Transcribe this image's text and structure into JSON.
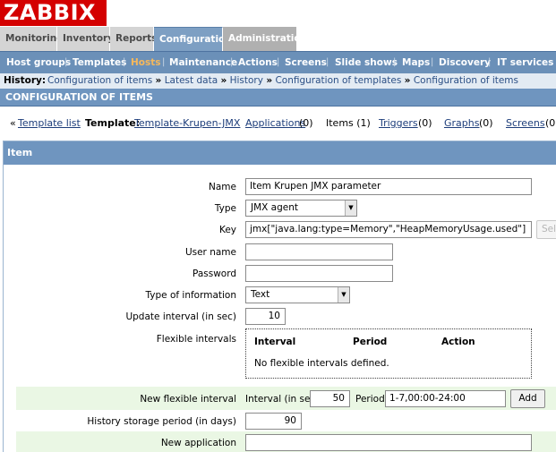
{
  "logo": "ZABBIX",
  "mainmenu": [
    "Monitoring",
    "Inventory",
    "Reports",
    "Configuration",
    "Administration"
  ],
  "submenu": [
    "Host groups",
    "Templates",
    "Hosts",
    "Maintenance",
    "Actions",
    "Screens",
    "Slide shows",
    "Maps",
    "Discovery",
    "IT services"
  ],
  "history": {
    "label": "History:",
    "crumbs": [
      "Configuration of items",
      "Latest data",
      "History",
      "Configuration of templates",
      "Configuration of items"
    ],
    "sep": "»"
  },
  "page_title": "CONFIGURATION OF ITEMS",
  "nav": {
    "lead": "«",
    "template_list": "Template list",
    "template_label": "Template:",
    "template_name": "Template-Krupen-JMX",
    "applications": "Applications",
    "applications_count": "(0)",
    "items": "Items (1)",
    "triggers": "Triggers",
    "triggers_count": "(0)",
    "graphs": "Graphs",
    "graphs_count": "(0)",
    "screens": "Screens",
    "screens_count": "(0"
  },
  "form_header": "Item",
  "form": {
    "name_label": "Name",
    "name_value": "Item Krupen JMX parameter",
    "type_label": "Type",
    "type_value": "JMX agent",
    "key_label": "Key",
    "key_value": "jmx[\"java.lang:type=Memory\",\"HeapMemoryUsage.used\"]",
    "key_select_btn": "Sel",
    "username_label": "User name",
    "username_value": "",
    "password_label": "Password",
    "password_value": "",
    "type_info_label": "Type of information",
    "type_info_value": "Text",
    "update_interval_label": "Update interval (in sec)",
    "update_interval_value": "10",
    "flexible_label": "Flexible intervals",
    "flex_col_interval": "Interval",
    "flex_col_period": "Period",
    "flex_col_action": "Action",
    "flex_empty": "No flexible intervals defined.",
    "new_flex_label": "New flexible interval",
    "new_flex_interval_label": "Interval (in sec)",
    "new_flex_interval_value": "50",
    "new_flex_period_label": "Period",
    "new_flex_period_value": "1-7,00:00-24:00",
    "add_btn": "Add",
    "history_label": "History storage period (in days)",
    "history_value": "90",
    "new_app_label": "New application",
    "new_app_value": ""
  },
  "colors": {
    "logo_red": "#d40000",
    "menu_active": "#7d9fc3",
    "submenu_bg": "#6b90b8",
    "selected_orange": "#f5b85c",
    "green_row": "#eaf7e4"
  }
}
